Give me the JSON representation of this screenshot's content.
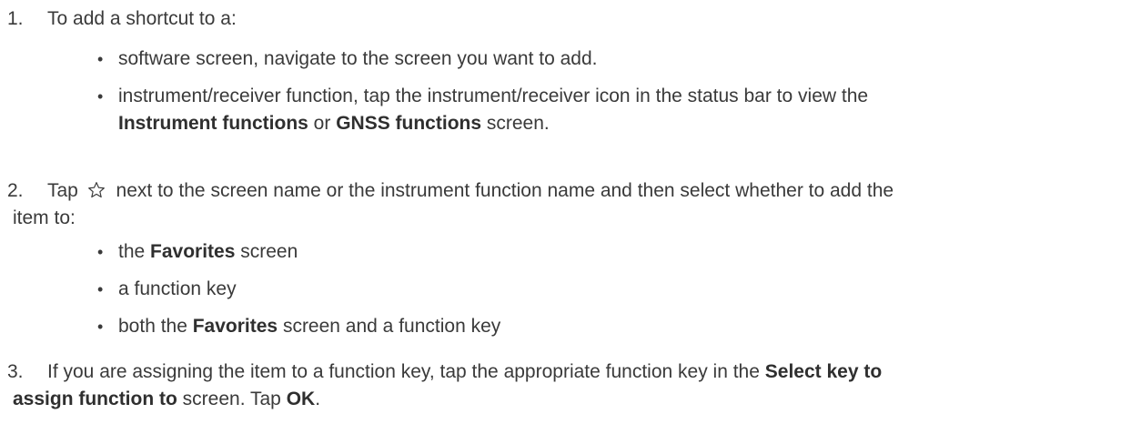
{
  "steps": [
    {
      "number": "1.",
      "text": "To add a shortcut to a:",
      "bullets": [
        {
          "pre": "software screen, navigate to the screen you want to add."
        },
        {
          "pre": "instrument/receiver function, tap the instrument/receiver icon in the status bar to view the",
          "bold1": "Instrument functions",
          "mid": " or ",
          "bold2": "GNSS functions",
          "post": " screen."
        }
      ]
    },
    {
      "number": "2.",
      "text_pre": "Tap ",
      "text_post": " next to the screen name or the instrument function name and then select whether to add the",
      "text_line2": "item to:",
      "bullets": [
        {
          "pre": "the ",
          "bold": "Favorites",
          "post": " screen"
        },
        {
          "pre": "a function key"
        },
        {
          "pre": "both the ",
          "bold": "Favorites",
          "post": " screen and a function key"
        }
      ]
    },
    {
      "number": "3.",
      "text_pre": "If you are assigning the item to a function key, tap the appropriate function key in the ",
      "bold1": "Select key to",
      "bold2": "assign function to",
      "text_mid": " screen. Tap ",
      "bold3": "OK",
      "text_post": "."
    }
  ],
  "bullet_glyph": "•",
  "icons": {
    "star": "star-outline-icon"
  }
}
